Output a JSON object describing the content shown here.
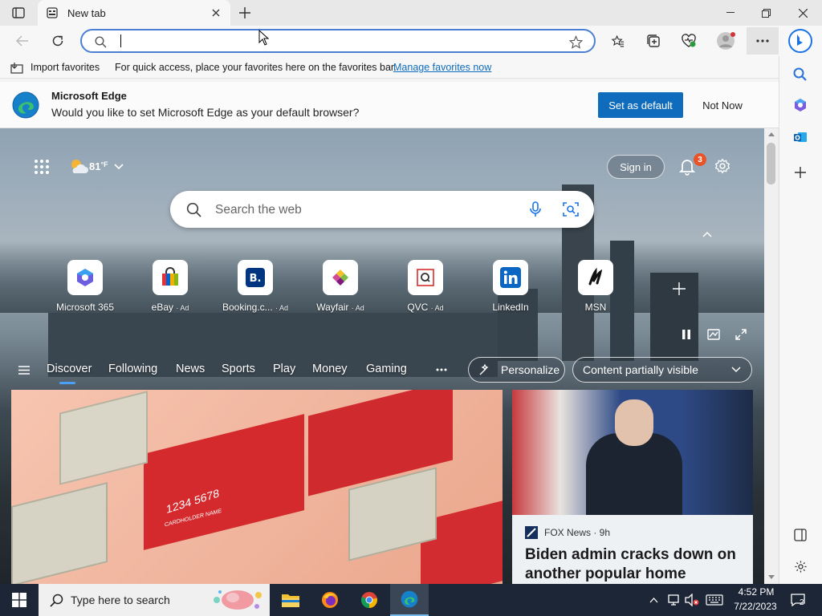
{
  "browser": {
    "tab_title": "New tab",
    "address_value": "",
    "favorites_bar": {
      "import_label": "Import favorites",
      "hint": "For quick access, place your favorites here on the favorites bar.",
      "manage_link": "Manage favorites now"
    },
    "default_banner": {
      "title": "Microsoft Edge",
      "message": "Would you like to set Microsoft Edge as your default browser?",
      "set_default": "Set as default",
      "not_now": "Not Now"
    }
  },
  "newtab": {
    "weather": "81",
    "weather_unit": "°F",
    "sign_in": "Sign in",
    "notification_count": "3",
    "search_placeholder": "Search the web",
    "quick_links": [
      {
        "label": "Microsoft 365",
        "ad": ""
      },
      {
        "label": "eBay",
        "ad": "· Ad"
      },
      {
        "label": "Booking.c...",
        "ad": "· Ad"
      },
      {
        "label": "Wayfair",
        "ad": "· Ad"
      },
      {
        "label": "QVC",
        "ad": "· Ad"
      },
      {
        "label": "LinkedIn",
        "ad": ""
      },
      {
        "label": "MSN",
        "ad": ""
      }
    ],
    "nav_tabs": [
      "Discover",
      "Following",
      "News",
      "Sports",
      "Play",
      "Money",
      "Gaming"
    ],
    "personalize": "Personalize",
    "content_visibility": "Content partially visible",
    "right_card": {
      "source": "FOX News · 9h",
      "headline": "Biden admin cracks down on another popular home"
    },
    "card_text": {
      "line1": "1234 5678",
      "line2": "CARDHOLDER NAME"
    }
  },
  "taskbar": {
    "search_placeholder": "Type here to search",
    "time": "4:52 PM",
    "date": "7/22/2023",
    "notif_count": "2"
  },
  "colors": {
    "accent": "#0f6cbd",
    "edge_blue": "#1a73e8"
  }
}
